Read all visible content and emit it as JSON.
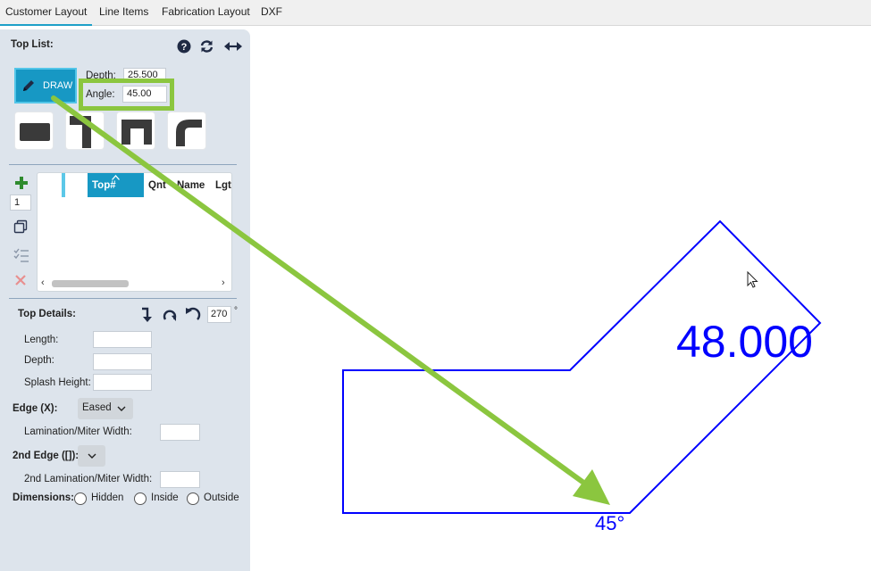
{
  "tabs": [
    {
      "label": "Customer Layout",
      "active": true
    },
    {
      "label": "Line Items",
      "active": false
    },
    {
      "label": "Fabrication Layout",
      "active": false
    },
    {
      "label": "DXF",
      "active": false
    }
  ],
  "top_list": {
    "title": "Top List:",
    "draw_label": "DRAW",
    "depth_label": "Depth:",
    "depth_value": "25.500",
    "angle_label": "Angle:",
    "angle_value": "45.00",
    "quantity_value": "1",
    "grid_columns": [
      "",
      "Top#",
      "Qnt",
      "Name",
      "Lgt"
    ]
  },
  "top_details": {
    "title": "Top Details:",
    "rotation_value": "270",
    "rotation_unit": "°",
    "length_label": "Length:",
    "depth_label": "Depth:",
    "splash_label": "Splash Height:",
    "edge_label": "Edge (X):",
    "edge_value": "Eased",
    "lamination_label": "Lamination/Miter Width:",
    "edge2_label": "2nd Edge ([]):",
    "lamination2_label": "2nd Lamination/Miter Width:",
    "dimensions_label": "Dimensions:",
    "dimension_options": [
      "Hidden",
      "Inside",
      "Outside"
    ]
  },
  "drawing": {
    "dimension_text": "48.000",
    "angle_text": "45°",
    "shape_color": "#0000ff",
    "arrow_color": "#8bc63f"
  },
  "colors": {
    "accent": "#1798c4",
    "panel_bg": "#dde4ec",
    "highlight": "#8bc63f"
  }
}
